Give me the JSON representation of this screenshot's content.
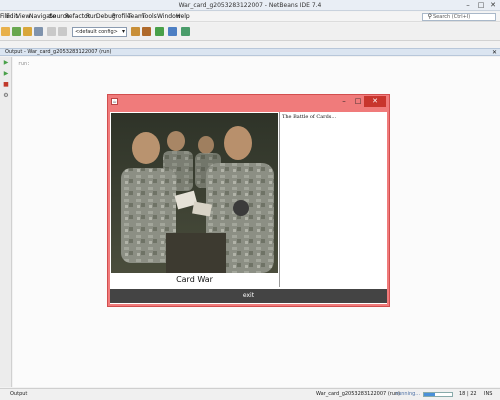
{
  "window": {
    "title": "War_card_g2053283122007 - NetBeans IDE 7.4"
  },
  "menu": [
    "File",
    "Edit",
    "View",
    "Navigate",
    "Source",
    "Refactor",
    "Run",
    "Debug",
    "Profile",
    "Team",
    "Tools",
    "Window",
    "Help"
  ],
  "search": {
    "placeholder": "Search (Ctrl+I)"
  },
  "toolbar": {
    "config_value": "<default config>"
  },
  "output": {
    "tab_title": "Output - War_card_g2053283122007 (run)",
    "run_line": "run:"
  },
  "app_window": {
    "caption": "Card War",
    "text_content": "The Battle of Cards...",
    "exit_label": "exit"
  },
  "status": {
    "output_label": "Output",
    "task": "War_card_g2053283122007 (run)",
    "running": "running...",
    "progress_fraction": 0.4,
    "position": "18 | 22",
    "mode": "INS"
  },
  "colors": {
    "frame_border": "#f07b7b",
    "close_button": "#c8352d",
    "exit_button": "#444444"
  }
}
